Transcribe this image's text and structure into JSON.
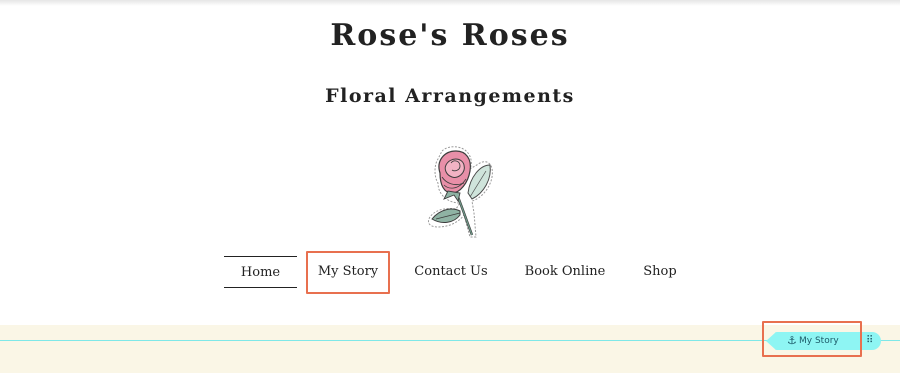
{
  "site": {
    "title": "Rose's Roses",
    "subtitle": "Floral Arrangements"
  },
  "logo": {
    "icon": "rose-sticker-icon"
  },
  "nav": {
    "items": [
      {
        "label": "Home",
        "active": true
      },
      {
        "label": "My Story",
        "active": false,
        "highlighted": true
      },
      {
        "label": "Contact Us",
        "active": false
      },
      {
        "label": "Book Online",
        "active": false
      },
      {
        "label": "Shop",
        "active": false
      }
    ]
  },
  "anchor": {
    "label": "My Story",
    "icon": "anchor-icon",
    "handle_icon": "drag-handle-icon",
    "color": "#8ef5f3"
  },
  "colors": {
    "highlight": "#e8704f",
    "strip_background": "#faf6e6",
    "anchor_line": "#7ee8e8"
  }
}
